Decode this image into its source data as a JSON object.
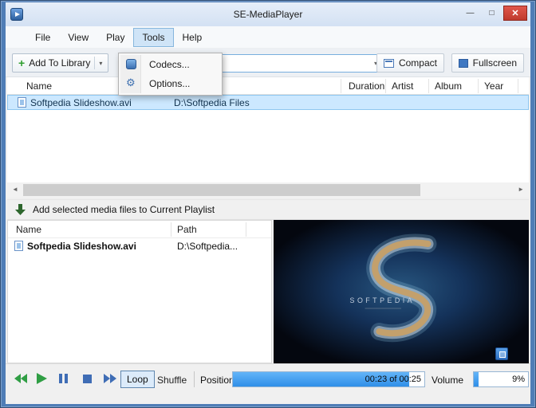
{
  "titlebar": {
    "title": "SE-MediaPlayer"
  },
  "icons": {
    "minimize": "—",
    "maximize": "□",
    "close": "✕",
    "plus": "+",
    "red_x": "✕",
    "caret_down": "▾",
    "arrow_left": "◄",
    "arrow_right": "►",
    "gear": "⚙"
  },
  "menubar": {
    "items": [
      {
        "label": "File"
      },
      {
        "label": "View"
      },
      {
        "label": "Play"
      },
      {
        "label": "Tools"
      },
      {
        "label": "Help"
      }
    ]
  },
  "tools_dropdown": {
    "items": [
      {
        "label": "Codecs..."
      },
      {
        "label": "Options..."
      }
    ]
  },
  "toolbar": {
    "add_to_library_label": "Add To Library",
    "search_value": "",
    "compact_label": "Compact",
    "fullscreen_label": "Fullscreen"
  },
  "library": {
    "headers": {
      "name": "Name",
      "duration": "Duration",
      "artist": "Artist",
      "album": "Album",
      "year": "Year"
    },
    "rows": [
      {
        "name": "Softpedia Slideshow.avi",
        "path": "D:\\Softpedia Files"
      }
    ]
  },
  "add_bar": {
    "label": "Add selected media files to Current Playlist"
  },
  "playlist": {
    "headers": {
      "name": "Name",
      "path": "Path"
    },
    "rows": [
      {
        "name": "Softpedia Slideshow.avi",
        "path": "D:\\Softpedia..."
      }
    ]
  },
  "video": {
    "watermark": "SOFTPEDIA"
  },
  "transport": {
    "loop_label": "Loop",
    "shuffle_label": "Shuffle",
    "position_label": "Position",
    "position_text": "00:23 of 00:25",
    "position_percent": 92,
    "volume_label": "Volume",
    "volume_text": "9%",
    "volume_percent": 9
  },
  "colors": {
    "window_frame": "#4f7db6",
    "selection_bg": "#cce8ff",
    "selection_border": "#8fc7f0",
    "progress_fill": "#2f8fe8",
    "close_button": "#bf3a2d"
  }
}
